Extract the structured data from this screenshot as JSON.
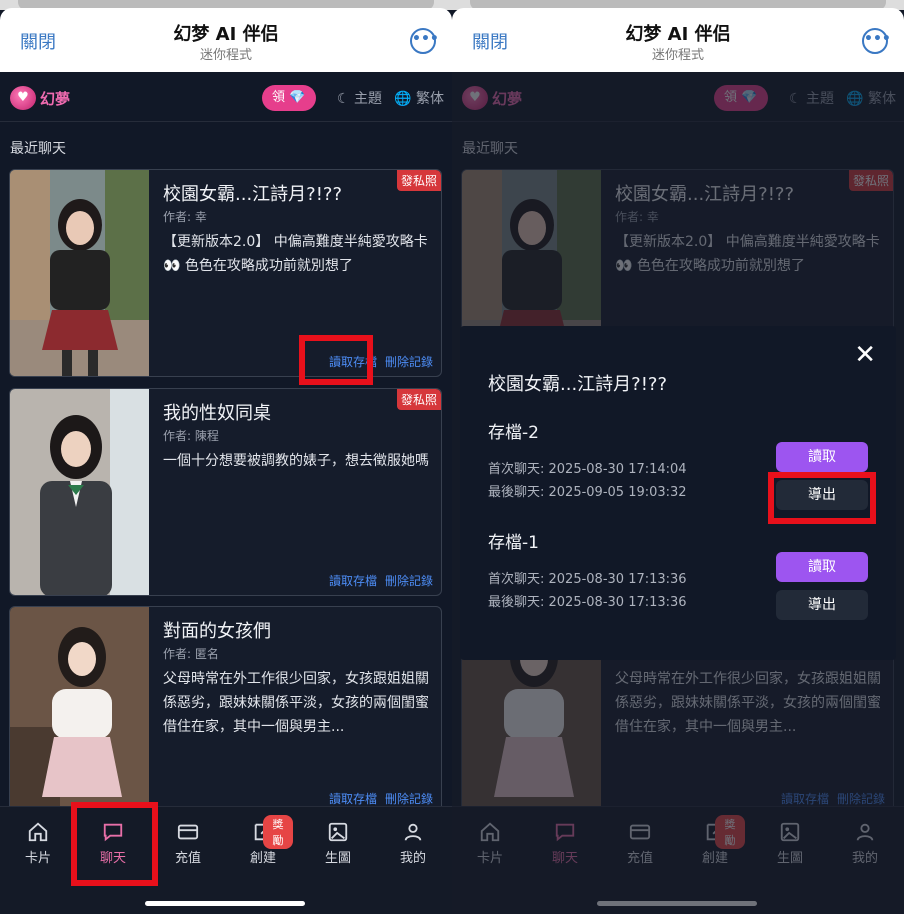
{
  "wechat": {
    "close": "關閉",
    "title": "幻梦 AI 伴侣",
    "subtitle": "迷你程式",
    "more": "•••"
  },
  "app": {
    "logo_text": "幻夢",
    "logo_glyph": "♥",
    "reward_label": "領",
    "reward_icon": "💎",
    "theme_label": "主題",
    "theme_icon": "☾",
    "lang_label": "繁体",
    "lang_icon": "🌐"
  },
  "section_title": "最近聊天",
  "cards": [
    {
      "title": "校園女霸...江詩月?!??",
      "author": "作者: 幸",
      "desc": "【更新版本2.0】 中偏高難度半純愛攻略卡👀 色色在攻略成功前就別想了",
      "badge": "發私照",
      "load": "讀取存檔",
      "delete": "刪除記錄"
    },
    {
      "title": "我的性奴同桌",
      "author": "作者: 陳程",
      "desc": "一個十分想要被調教的婊子，想去徵服她嗎",
      "badge": "發私照",
      "load": "讀取存檔",
      "delete": "刪除記錄"
    },
    {
      "title": "對面的女孩們",
      "author": "作者: 匿名",
      "desc": "父母時常在外工作很少回家，女孩跟姐姐關係惡劣，跟妹妹關係平淡，女孩的兩個閨蜜借住在家，其中一個與男主...",
      "badge": "",
      "load": "讀取存檔",
      "delete": "刪除記錄"
    }
  ],
  "nav": [
    {
      "label": "卡片",
      "icon": "home-icon"
    },
    {
      "label": "聊天",
      "icon": "chat-icon"
    },
    {
      "label": "充值",
      "icon": "card-icon"
    },
    {
      "label": "創建",
      "icon": "edit-icon",
      "badge": "獎勵"
    },
    {
      "label": "生圖",
      "icon": "image-icon"
    },
    {
      "label": "我的",
      "icon": "user-icon"
    }
  ],
  "active_nav": "聊天",
  "modal": {
    "close": "✕",
    "title": "校園女霸...江詩月?!??",
    "saves": [
      {
        "name": "存檔-2",
        "first": "首次聊天: 2025-08-30 17:14:04",
        "last": "最後聊天: 2025-09-05 19:03:32",
        "read": "讀取",
        "export": "導出"
      },
      {
        "name": "存檔-1",
        "first": "首次聊天: 2025-08-30 17:13:36",
        "last": "最後聊天: 2025-08-30 17:13:36",
        "read": "讀取",
        "export": "導出"
      }
    ]
  },
  "colors": {
    "accent_pink": "#e63e8c",
    "link_blue": "#4d8df6",
    "purple_button": "#9d55f0",
    "badge_red": "#d6373b",
    "highlight_red": "#e8101b"
  }
}
